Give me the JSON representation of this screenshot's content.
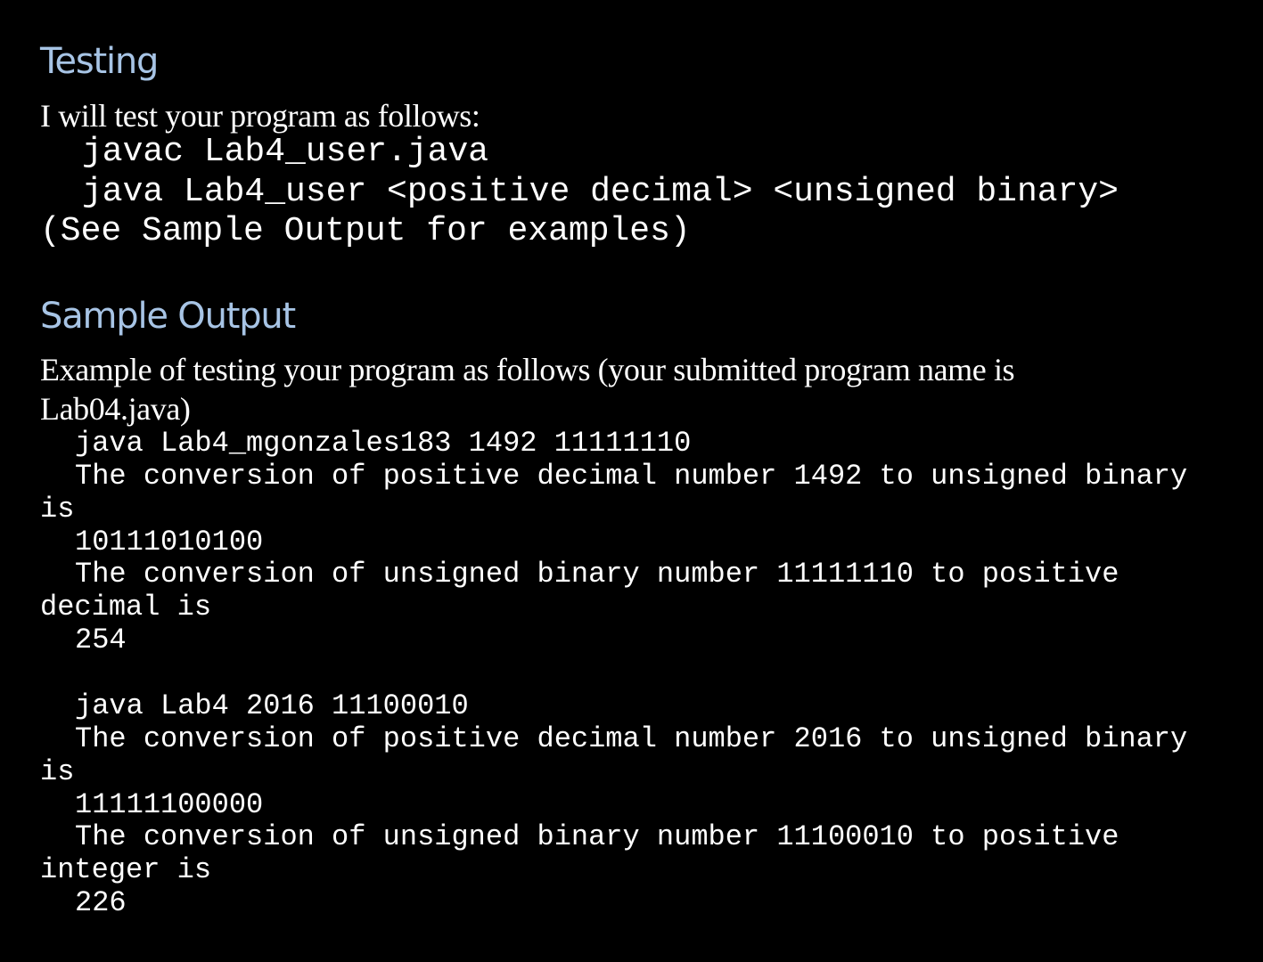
{
  "sections": {
    "testing": {
      "heading": "Testing",
      "intro": "I will test your program as follows:",
      "commands": [
        "javac Lab4_user.java",
        "java Lab4_user <positive decimal> <unsigned binary>"
      ],
      "note": "(See Sample Output for examples)"
    },
    "sample_output": {
      "heading": "Sample Output",
      "intro_line1": "Example of testing your program as follows (your submitted program name is",
      "intro_line2": "Lab04.java)",
      "example1": {
        "command": "java Lab4_mgonzales183 1492 11111110",
        "line1a": "The conversion of positive decimal number 1492 to unsigned binary",
        "line1b": "is",
        "result1": "10111010100",
        "line2a": "The conversion of unsigned binary number 11111110 to positive",
        "line2b": "decimal is",
        "result2": "254"
      },
      "example2": {
        "command": "java Lab4 2016 11100010",
        "line1a": "The conversion of positive decimal number 2016 to unsigned binary",
        "line1b": "is",
        "result1": "11111100000",
        "line2a": "The conversion of unsigned binary number 11100010 to positive",
        "line2b": "integer is",
        "result2": "226"
      }
    }
  }
}
